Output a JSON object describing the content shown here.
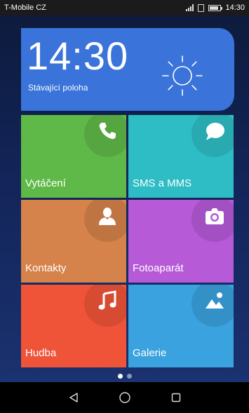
{
  "status_bar": {
    "carrier": "T-Mobile CZ",
    "time": "14:30",
    "battery_level": 0.85
  },
  "clock_widget": {
    "time": "14:30",
    "location": "Stávající poloha",
    "weather_icon": "sun-icon",
    "color": "#3a73d9"
  },
  "tiles": [
    {
      "label": "Vytáčení",
      "icon": "phone-icon",
      "color": "#5fb948"
    },
    {
      "label": "SMS a MMS",
      "icon": "message-icon",
      "color": "#2ebdc4"
    },
    {
      "label": "Kontakty",
      "icon": "contact-icon",
      "color": "#d5834a"
    },
    {
      "label": "Fotoaparát",
      "icon": "camera-icon",
      "color": "#b65ad8"
    },
    {
      "label": "Hudba",
      "icon": "music-icon",
      "color": "#ef5438"
    },
    {
      "label": "Galerie",
      "icon": "gallery-icon",
      "color": "#3aa2de"
    }
  ],
  "page_indicator": {
    "pages": 2,
    "current": 1
  },
  "nav_bar": {
    "items": [
      "back-icon",
      "home-icon",
      "recents-icon"
    ]
  }
}
